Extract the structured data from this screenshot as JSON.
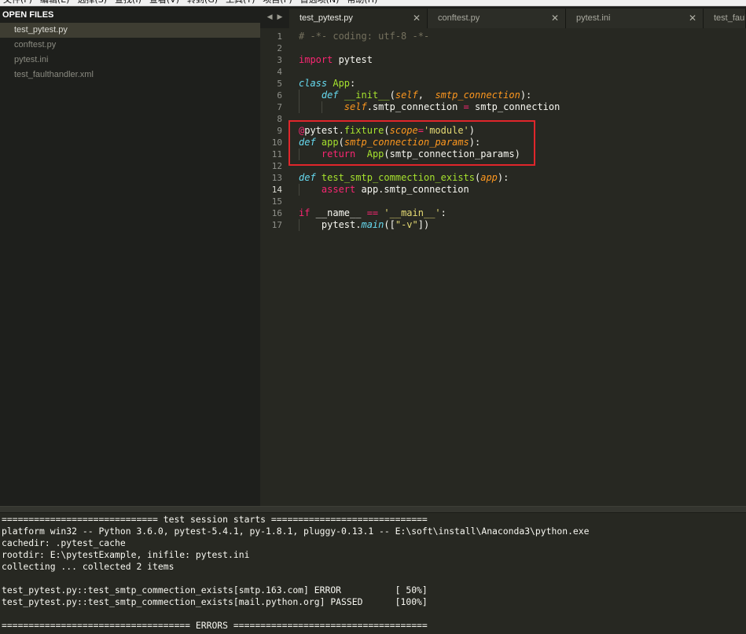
{
  "menu": [
    "文件(F)",
    "编辑(E)",
    "选择(S)",
    "查找(I)",
    "查看(V)",
    "转到(G)",
    "工具(T)",
    "项目(P)",
    "首选项(N)",
    "帮助(H)"
  ],
  "sidebar": {
    "header": "OPEN FILES",
    "files": [
      "test_pytest.py",
      "conftest.py",
      "pytest.ini",
      "test_faulthandler.xml"
    ]
  },
  "tabs": {
    "nav_left": "◀",
    "nav_right": "▶",
    "items": [
      {
        "label": "test_pytest.py",
        "close": "✕"
      },
      {
        "label": "conftest.py",
        "close": "✕"
      },
      {
        "label": "pytest.ini",
        "close": "✕"
      },
      {
        "label": "test_faulthandler.xml",
        "close": ""
      }
    ]
  },
  "editor": {
    "line_numbers": [
      "1",
      "2",
      "3",
      "4",
      "5",
      "6",
      "7",
      "8",
      "9",
      "10",
      "11",
      "12",
      "13",
      "14",
      "15",
      "16",
      "17"
    ],
    "current_line": "14",
    "lines": [
      [
        {
          "t": "# -*- coding: utf-8 -*-",
          "c": "c"
        }
      ],
      [],
      [
        {
          "t": "import",
          "c": "k"
        },
        {
          "t": " pytest",
          "c": ""
        }
      ],
      [],
      [
        {
          "t": "class",
          "c": "st"
        },
        {
          "t": " ",
          "c": ""
        },
        {
          "t": "App",
          "c": "f"
        },
        {
          "t": ":",
          "c": ""
        }
      ],
      [
        {
          "t": "    ",
          "c": ""
        },
        {
          "t": "def",
          "c": "st"
        },
        {
          "t": " ",
          "c": ""
        },
        {
          "t": "__init__",
          "c": "f"
        },
        {
          "t": "(",
          "c": ""
        },
        {
          "t": "self",
          "c": "p"
        },
        {
          "t": ",  ",
          "c": ""
        },
        {
          "t": "smtp_connection",
          "c": "p"
        },
        {
          "t": "):",
          "c": ""
        }
      ],
      [
        {
          "t": "        ",
          "c": ""
        },
        {
          "t": "self",
          "c": "sf"
        },
        {
          "t": ".smtp_connection ",
          "c": ""
        },
        {
          "t": "=",
          "c": "k"
        },
        {
          "t": " smtp_connection",
          "c": ""
        }
      ],
      [],
      [
        {
          "t": "@",
          "c": "k"
        },
        {
          "t": "pytest.",
          "c": ""
        },
        {
          "t": "fixture",
          "c": "f"
        },
        {
          "t": "(",
          "c": ""
        },
        {
          "t": "scope",
          "c": "p"
        },
        {
          "t": "=",
          "c": "k"
        },
        {
          "t": "'module'",
          "c": "s"
        },
        {
          "t": ")",
          "c": ""
        }
      ],
      [
        {
          "t": "def",
          "c": "st"
        },
        {
          "t": " ",
          "c": ""
        },
        {
          "t": "app",
          "c": "f"
        },
        {
          "t": "(",
          "c": ""
        },
        {
          "t": "smtp_connection_params",
          "c": "p"
        },
        {
          "t": "):",
          "c": ""
        }
      ],
      [
        {
          "t": "    ",
          "c": ""
        },
        {
          "t": "return",
          "c": "k"
        },
        {
          "t": "  ",
          "c": ""
        },
        {
          "t": "App",
          "c": "f"
        },
        {
          "t": "(smtp_connection_params)",
          "c": ""
        }
      ],
      [],
      [
        {
          "t": "def",
          "c": "st"
        },
        {
          "t": " ",
          "c": ""
        },
        {
          "t": "test_smtp_commection_exists",
          "c": "f"
        },
        {
          "t": "(",
          "c": ""
        },
        {
          "t": "app",
          "c": "p"
        },
        {
          "t": "):",
          "c": ""
        }
      ],
      [
        {
          "t": "    ",
          "c": ""
        },
        {
          "t": "assert",
          "c": "k"
        },
        {
          "t": " app.smtp_connection",
          "c": ""
        }
      ],
      [],
      [
        {
          "t": "if",
          "c": "k"
        },
        {
          "t": " __name__ ",
          "c": ""
        },
        {
          "t": "==",
          "c": "k"
        },
        {
          "t": " ",
          "c": ""
        },
        {
          "t": "'__main__'",
          "c": "s"
        },
        {
          "t": ":",
          "c": ""
        }
      ],
      [
        {
          "t": "    pytest.",
          "c": ""
        },
        {
          "t": "main",
          "c": "st"
        },
        {
          "t": "([",
          "c": ""
        },
        {
          "t": "\"-v\"",
          "c": "s"
        },
        {
          "t": "])",
          "c": ""
        }
      ]
    ]
  },
  "console": {
    "lines": [
      "============================= test session starts =============================",
      "platform win32 -- Python 3.6.0, pytest-5.4.1, py-1.8.1, pluggy-0.13.1 -- E:\\soft\\install\\Anaconda3\\python.exe",
      "cachedir: .pytest_cache",
      "rootdir: E:\\pytestExample, inifile: pytest.ini",
      "collecting ... collected 2 items",
      "",
      "test_pytest.py::test_smtp_commection_exists[smtp.163.com] ERROR          [ 50%]",
      "test_pytest.py::test_smtp_commection_exists[mail.python.org] PASSED      [100%]",
      "",
      "=================================== ERRORS ===================================="
    ]
  }
}
